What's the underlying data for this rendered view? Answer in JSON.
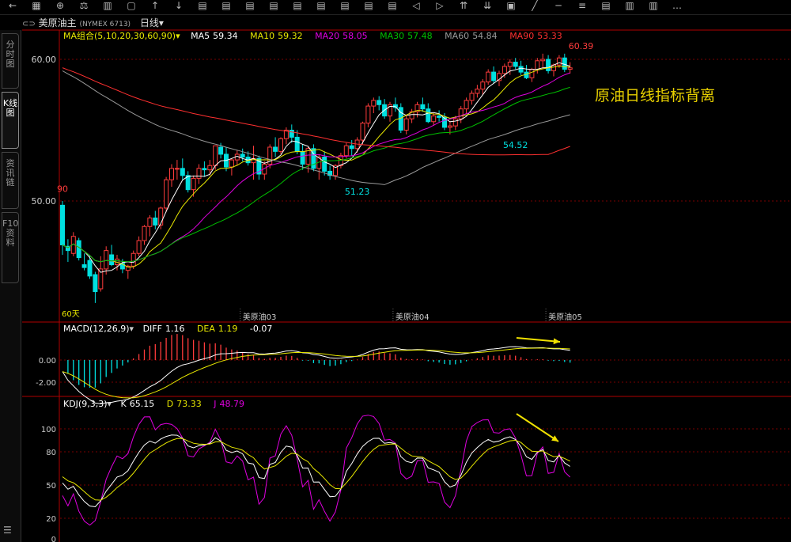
{
  "header": {
    "symbol": "美原油主",
    "exchange": "(NYMEX 6713)",
    "period": "日线",
    "toolbar_icons": [
      "back-arrow-icon",
      "calculator-icon",
      "zoom-icon",
      "scale-icon",
      "chart-icon",
      "window-icon",
      "arrow-up-icon",
      "arrow-down-icon",
      "chart-period-icon",
      "chart-period-icon",
      "chart-period-icon",
      "chart-period-icon",
      "chart-period-icon",
      "chart-period-icon",
      "chart-period-icon",
      "chart-period-icon",
      "chart-period-icon",
      "nav-left-icon",
      "nav-right-icon",
      "double-up-icon",
      "double-down-icon",
      "bookmark-icon",
      "line-draw-icon",
      "hline-icon",
      "multi-line-icon",
      "text-icon",
      "note-icon",
      "bars-icon",
      "more-icon"
    ]
  },
  "sidebar": {
    "tabs": [
      "分时图",
      "K线图",
      "资讯链",
      "F10资料"
    ],
    "active": 1
  },
  "chart_data": {
    "type": "candlestick",
    "main": {
      "ma_label": "MA组合(5,10,20,30,60,90)",
      "legend": [
        {
          "name": "MA5",
          "value": "59.34",
          "color": "#ffffff"
        },
        {
          "name": "MA10",
          "value": "59.32",
          "color": "#e8e800"
        },
        {
          "name": "MA20",
          "value": "58.05",
          "color": "#e000e0"
        },
        {
          "name": "MA30",
          "value": "57.48",
          "color": "#00c000"
        },
        {
          "name": "MA60",
          "value": "54.84",
          "color": "#9a9a9a"
        },
        {
          "name": "MA90",
          "value": "53.33",
          "color": "#ff3030"
        }
      ],
      "ylim": [
        42.9,
        61.8
      ],
      "yticks": [
        "60.00",
        "50.00"
      ],
      "month_labels": [
        "美原油03",
        "美原油04",
        "美原油05"
      ],
      "month_idx": [
        33,
        61,
        89
      ],
      "annotations": [
        {
          "text": "60.39",
          "idx": 95,
          "price": 60.39
        },
        {
          "text": "54.52",
          "idx": 83,
          "price": 54.52
        },
        {
          "text": "51.23",
          "idx": 54,
          "price": 51.23
        },
        {
          "text": "90",
          "idx": 0,
          "price": 50.3
        }
      ],
      "left_note": "60天",
      "overlay_text": "原油日线指标背离",
      "ohlc": [
        [
          49.7,
          50.0,
          46.2,
          46.9
        ],
        [
          46.8,
          47.3,
          45.7,
          46.5
        ],
        [
          46.3,
          47.8,
          46.1,
          47.5
        ],
        [
          47.2,
          47.4,
          45.8,
          46.0
        ],
        [
          45.5,
          46.3,
          45.1,
          45.3
        ],
        [
          45.8,
          46.2,
          44.5,
          44.7
        ],
        [
          44.8,
          45.0,
          42.8,
          43.6
        ],
        [
          43.8,
          46.1,
          43.6,
          45.2
        ],
        [
          45.2,
          46.8,
          44.8,
          46.5
        ],
        [
          46.2,
          46.9,
          45.4,
          45.5
        ],
        [
          45.5,
          46.2,
          45.1,
          45.9
        ],
        [
          45.6,
          45.9,
          44.9,
          45.2
        ],
        [
          45.1,
          45.5,
          44.5,
          45.4
        ],
        [
          45.4,
          46.5,
          45.2,
          46.3
        ],
        [
          46.3,
          47.5,
          46.1,
          47.2
        ],
        [
          47.2,
          48.3,
          46.9,
          48.2
        ],
        [
          48.2,
          49.0,
          47.5,
          48.8
        ],
        [
          48.8,
          49.3,
          48.0,
          48.3
        ],
        [
          48.3,
          49.6,
          48.0,
          49.5
        ],
        [
          49.5,
          51.7,
          49.2,
          51.5
        ],
        [
          51.5,
          52.6,
          51.0,
          52.3
        ],
        [
          52.3,
          52.9,
          51.5,
          52.3
        ],
        [
          52.3,
          53.0,
          51.5,
          51.8
        ],
        [
          51.8,
          52.1,
          50.6,
          50.8
        ],
        [
          50.8,
          51.8,
          50.3,
          51.6
        ],
        [
          51.6,
          52.6,
          51.2,
          52.3
        ],
        [
          52.3,
          52.8,
          51.7,
          52.2
        ],
        [
          52.2,
          52.9,
          51.8,
          52.5
        ],
        [
          52.5,
          53.8,
          52.2,
          53.9
        ],
        [
          53.8,
          54.1,
          53.0,
          53.3
        ],
        [
          53.3,
          53.8,
          52.1,
          52.4
        ],
        [
          52.4,
          53.0,
          51.8,
          52.9
        ],
        [
          52.9,
          53.6,
          52.5,
          53.3
        ],
        [
          53.3,
          53.7,
          52.8,
          53.1
        ],
        [
          53.1,
          53.5,
          52.5,
          52.7
        ],
        [
          52.7,
          53.9,
          51.5,
          53.0
        ],
        [
          53.0,
          53.2,
          51.5,
          51.9
        ],
        [
          51.9,
          52.8,
          51.5,
          52.6
        ],
        [
          52.6,
          54.0,
          52.3,
          53.8
        ],
        [
          53.8,
          54.5,
          53.1,
          53.5
        ],
        [
          53.5,
          54.5,
          53.3,
          54.4
        ],
        [
          54.4,
          55.2,
          54.0,
          55.0
        ],
        [
          55.0,
          55.4,
          54.1,
          54.5
        ],
        [
          54.5,
          55.0,
          53.3,
          53.5
        ],
        [
          53.5,
          54.0,
          52.2,
          52.6
        ],
        [
          52.6,
          53.8,
          52.0,
          53.7
        ],
        [
          53.7,
          54.0,
          52.1,
          52.3
        ],
        [
          52.3,
          53.3,
          51.5,
          53.1
        ],
        [
          53.1,
          53.5,
          51.8,
          52.1
        ],
        [
          52.1,
          52.5,
          51.5,
          51.8
        ],
        [
          51.8,
          52.6,
          51.5,
          52.5
        ],
        [
          52.5,
          53.4,
          52.3,
          53.2
        ],
        [
          53.2,
          54.1,
          53.0,
          53.9
        ],
        [
          53.9,
          54.3,
          53.2,
          53.7
        ],
        [
          53.7,
          54.5,
          53.4,
          54.3
        ],
        [
          54.3,
          55.6,
          54.0,
          55.5
        ],
        [
          55.5,
          56.9,
          55.2,
          56.7
        ],
        [
          56.7,
          57.3,
          56.2,
          57.1
        ],
        [
          57.1,
          57.4,
          56.4,
          56.8
        ],
        [
          56.8,
          57.2,
          55.8,
          56.0
        ],
        [
          56.0,
          57.0,
          55.6,
          56.8
        ],
        [
          56.8,
          57.3,
          56.3,
          56.6
        ],
        [
          56.6,
          56.9,
          54.8,
          55.0
        ],
        [
          55.0,
          56.1,
          54.7,
          55.8
        ],
        [
          55.8,
          56.5,
          55.5,
          56.3
        ],
        [
          56.3,
          57.0,
          55.9,
          56.8
        ],
        [
          56.8,
          57.3,
          56.3,
          56.5
        ],
        [
          56.5,
          56.9,
          55.5,
          55.6
        ],
        [
          55.6,
          56.2,
          55.3,
          56.0
        ],
        [
          56.0,
          56.4,
          55.6,
          55.9
        ],
        [
          55.9,
          56.2,
          55.0,
          55.2
        ],
        [
          55.2,
          55.6,
          54.7,
          55.3
        ],
        [
          55.3,
          56.0,
          55.0,
          55.8
        ],
        [
          55.8,
          56.7,
          55.5,
          56.5
        ],
        [
          56.5,
          57.3,
          56.2,
          57.1
        ],
        [
          57.1,
          57.8,
          56.8,
          57.6
        ],
        [
          57.6,
          58.2,
          57.3,
          57.9
        ],
        [
          57.9,
          58.6,
          57.5,
          58.4
        ],
        [
          58.4,
          59.3,
          58.2,
          59.1
        ],
        [
          59.1,
          59.5,
          58.3,
          58.5
        ],
        [
          58.5,
          59.2,
          58.1,
          59.0
        ],
        [
          59.0,
          59.7,
          58.7,
          59.5
        ],
        [
          59.5,
          60.0,
          58.9,
          59.8
        ],
        [
          59.8,
          60.1,
          59.3,
          59.5
        ],
        [
          59.5,
          59.9,
          58.9,
          59.1
        ],
        [
          59.1,
          59.6,
          58.6,
          58.7
        ],
        [
          58.7,
          59.4,
          58.4,
          59.3
        ],
        [
          59.3,
          60.1,
          59.0,
          59.9
        ],
        [
          59.9,
          60.4,
          59.4,
          60.0
        ],
        [
          60.0,
          60.3,
          59.0,
          59.2
        ],
        [
          59.2,
          59.7,
          58.8,
          59.6
        ],
        [
          59.6,
          60.3,
          59.4,
          60.1
        ],
        [
          60.1,
          60.4,
          59.1,
          59.3
        ],
        [
          59.3,
          59.8,
          59.0,
          59.4
        ]
      ]
    },
    "macd": {
      "label": "MACD(12,26,9)",
      "diff_label": "DIFF",
      "diff": "1.16",
      "dea_label": "DEA",
      "dea": "1.19",
      "macd": "-0.07",
      "yticks": [
        "0.00",
        "-2.00"
      ],
      "ylim": [
        -2.9,
        2.7
      ]
    },
    "kdj": {
      "label": "KDJ(9,3,3)",
      "k_label": "K",
      "k": "65.15",
      "d_label": "D",
      "d": "73.33",
      "j_label": "J",
      "j": "48.79",
      "yticks": [
        "100",
        "80",
        "50",
        "20",
        "0"
      ],
      "ylim": [
        0,
        125
      ]
    }
  }
}
